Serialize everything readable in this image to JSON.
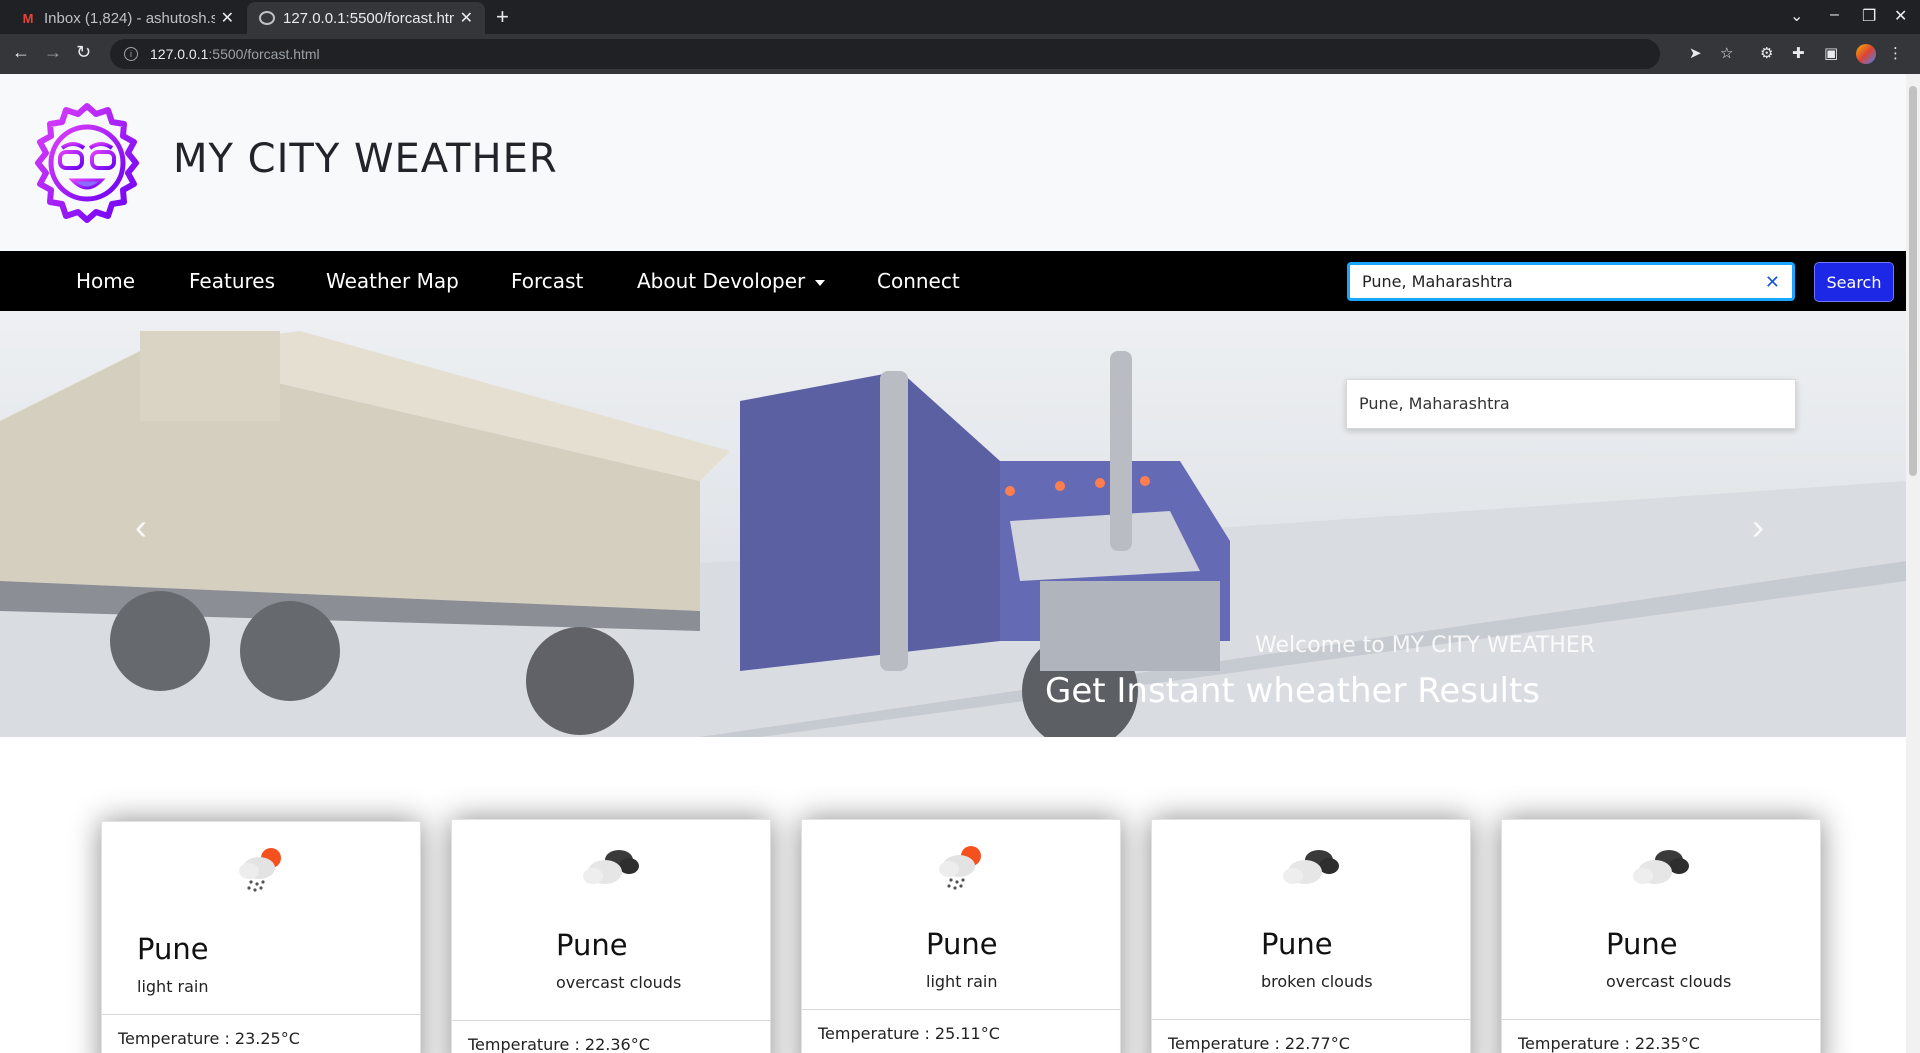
{
  "browser": {
    "tabs": [
      {
        "title": "Inbox (1,824) - ashutosh.s",
        "icon": "gmail-icon",
        "active": false
      },
      {
        "title": "127.0.0.1:5500/forcast.htm",
        "icon": "globe-icon",
        "active": true
      }
    ],
    "url_host": "127.0.0.1",
    "url_path": ":5500/forcast.html"
  },
  "header": {
    "site_title": "MY CITY WEATHER"
  },
  "nav": {
    "items": [
      "Home",
      "Features",
      "Weather Map",
      "Forcast",
      "About Devoloper",
      "Connect"
    ],
    "search_value": "Pune, Maharashtra",
    "search_button": "Search",
    "suggestion": "Pune, Maharashtra"
  },
  "hero": {
    "subtitle": "Welcome to MY CITY WEATHER",
    "heading": "Get Instant wheather Results"
  },
  "forecast": [
    {
      "city": "Pune",
      "description": "light rain",
      "temperature": "Temperature : 23.25°C",
      "icon": "light-rain-icon"
    },
    {
      "city": "Pune",
      "description": "overcast clouds",
      "temperature": "Temperature : 22.36°C",
      "icon": "overcast-clouds-icon"
    },
    {
      "city": "Pune",
      "description": "light rain",
      "temperature": "Temperature : 25.11°C",
      "icon": "light-rain-icon"
    },
    {
      "city": "Pune",
      "description": "broken clouds",
      "temperature": "Temperature : 22.77°C",
      "icon": "broken-clouds-icon"
    },
    {
      "city": "Pune",
      "description": "overcast clouds",
      "temperature": "Temperature : 22.35°C",
      "icon": "overcast-clouds-icon"
    }
  ],
  "colors": {
    "navbar_bg": "#000000",
    "search_button": "#1d28e6",
    "search_border": "#19a6ff",
    "logo_gradient_start": "#e040fb",
    "logo_gradient_end": "#6a00f4"
  }
}
